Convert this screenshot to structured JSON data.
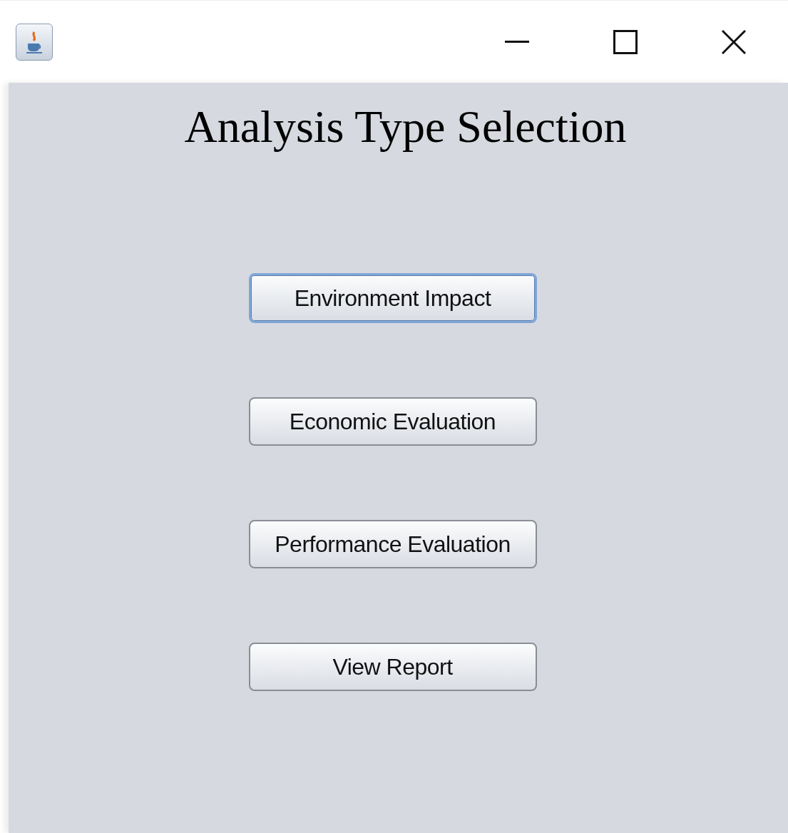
{
  "window": {
    "controls": [
      {
        "kind": "minimize"
      },
      {
        "kind": "maximize"
      },
      {
        "kind": "close"
      }
    ]
  },
  "title": "Analysis Type Selection",
  "buttons": [
    {
      "label": "Environment Impact",
      "focused": true
    },
    {
      "label": "Economic Evaluation",
      "focused": false
    },
    {
      "label": "Performance Evaluation",
      "focused": false
    },
    {
      "label": "View Report",
      "focused": false
    }
  ]
}
